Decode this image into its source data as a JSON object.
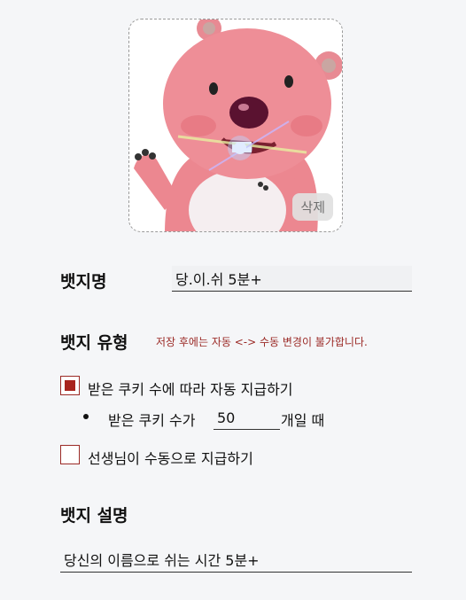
{
  "image": {
    "alt_icon": "badge-image",
    "delete_label": "삭제"
  },
  "badge_name": {
    "label": "뱃지명",
    "value": "당.이.쉬 5분+"
  },
  "badge_type": {
    "label": "뱃지 유형",
    "warning": "저장 후에는 자동 <-> 수동 변경이 불가합니다.",
    "options": [
      {
        "label": "받은 쿠키 수에 따라 자동 지급하기",
        "checked": true
      },
      {
        "label": "선생님이 수동으로 지급하기",
        "checked": false
      }
    ],
    "condition": {
      "prefix": "받은 쿠키 수가",
      "value": "50",
      "suffix": "개일 때"
    }
  },
  "badge_desc": {
    "label": "뱃지 설명",
    "value": "당신의 이름으로 쉬는 시간 5분+"
  },
  "colors": {
    "accent": "#a8231d",
    "warning": "#9b2a26",
    "background": "#f5f6f8"
  }
}
